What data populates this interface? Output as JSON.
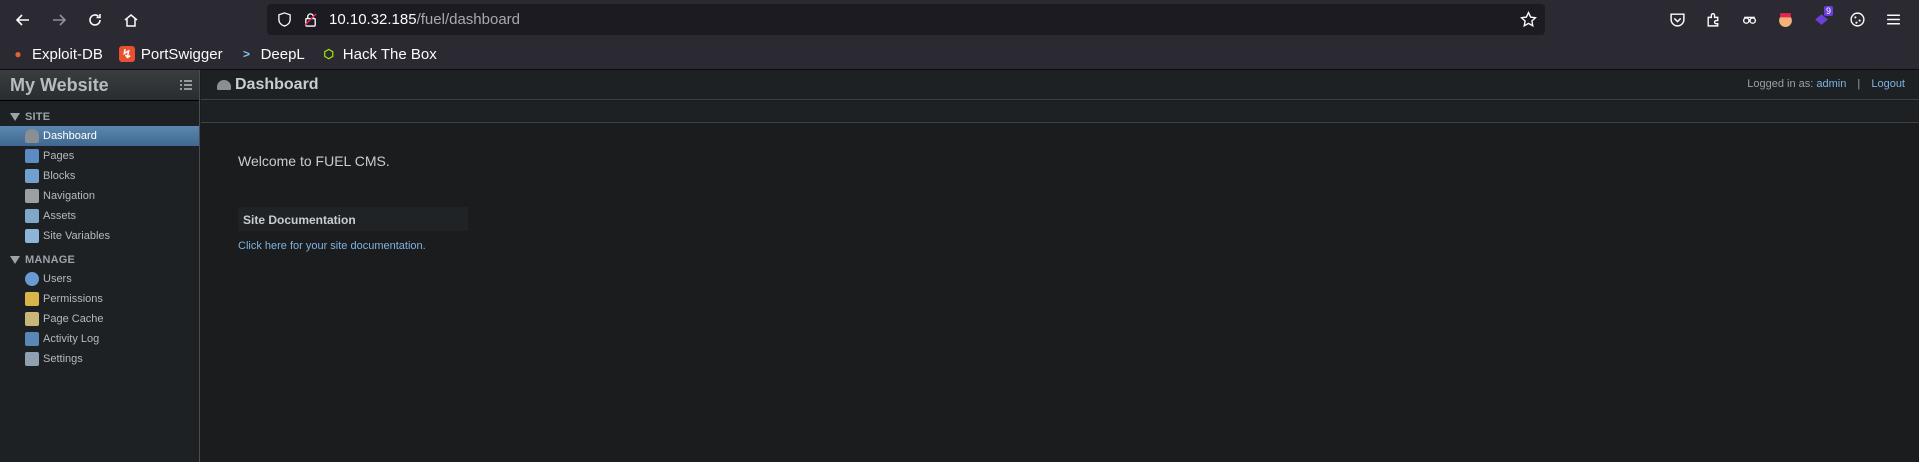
{
  "browser": {
    "url_host": "10.10.32.185",
    "url_path": "/fuel/dashboard",
    "extension_badge": "9",
    "bookmarks": [
      {
        "label": "Exploit-DB",
        "icon": "exploit-db-icon",
        "color": "#e0642f"
      },
      {
        "label": "PortSwigger",
        "icon": "portswigger-icon",
        "color": "#e8502f"
      },
      {
        "label": "DeepL",
        "icon": "deepl-icon",
        "color": "#7fc4f5"
      },
      {
        "label": "Hack The Box",
        "icon": "htb-icon",
        "color": "#9fef00"
      }
    ]
  },
  "app": {
    "site_title": "My Website",
    "page_title": "Dashboard",
    "login_prefix": "Logged in as:",
    "login_user": "admin",
    "logout": "Logout",
    "sections": [
      {
        "title": "SITE",
        "items": [
          {
            "label": "Dashboard",
            "icon": "dashboard-icon",
            "active": true
          },
          {
            "label": "Pages",
            "icon": "pages-icon"
          },
          {
            "label": "Blocks",
            "icon": "blocks-icon"
          },
          {
            "label": "Navigation",
            "icon": "navigation-icon"
          },
          {
            "label": "Assets",
            "icon": "assets-icon"
          },
          {
            "label": "Site Variables",
            "icon": "site-variables-icon"
          }
        ]
      },
      {
        "title": "MANAGE",
        "items": [
          {
            "label": "Users",
            "icon": "users-icon"
          },
          {
            "label": "Permissions",
            "icon": "permissions-icon"
          },
          {
            "label": "Page Cache",
            "icon": "page-cache-icon"
          },
          {
            "label": "Activity Log",
            "icon": "activity-log-icon"
          },
          {
            "label": "Settings",
            "icon": "settings-icon"
          }
        ]
      }
    ],
    "welcome": "Welcome to FUEL CMS.",
    "doc_heading": "Site Documentation",
    "doc_link": "Click here for your site documentation."
  }
}
